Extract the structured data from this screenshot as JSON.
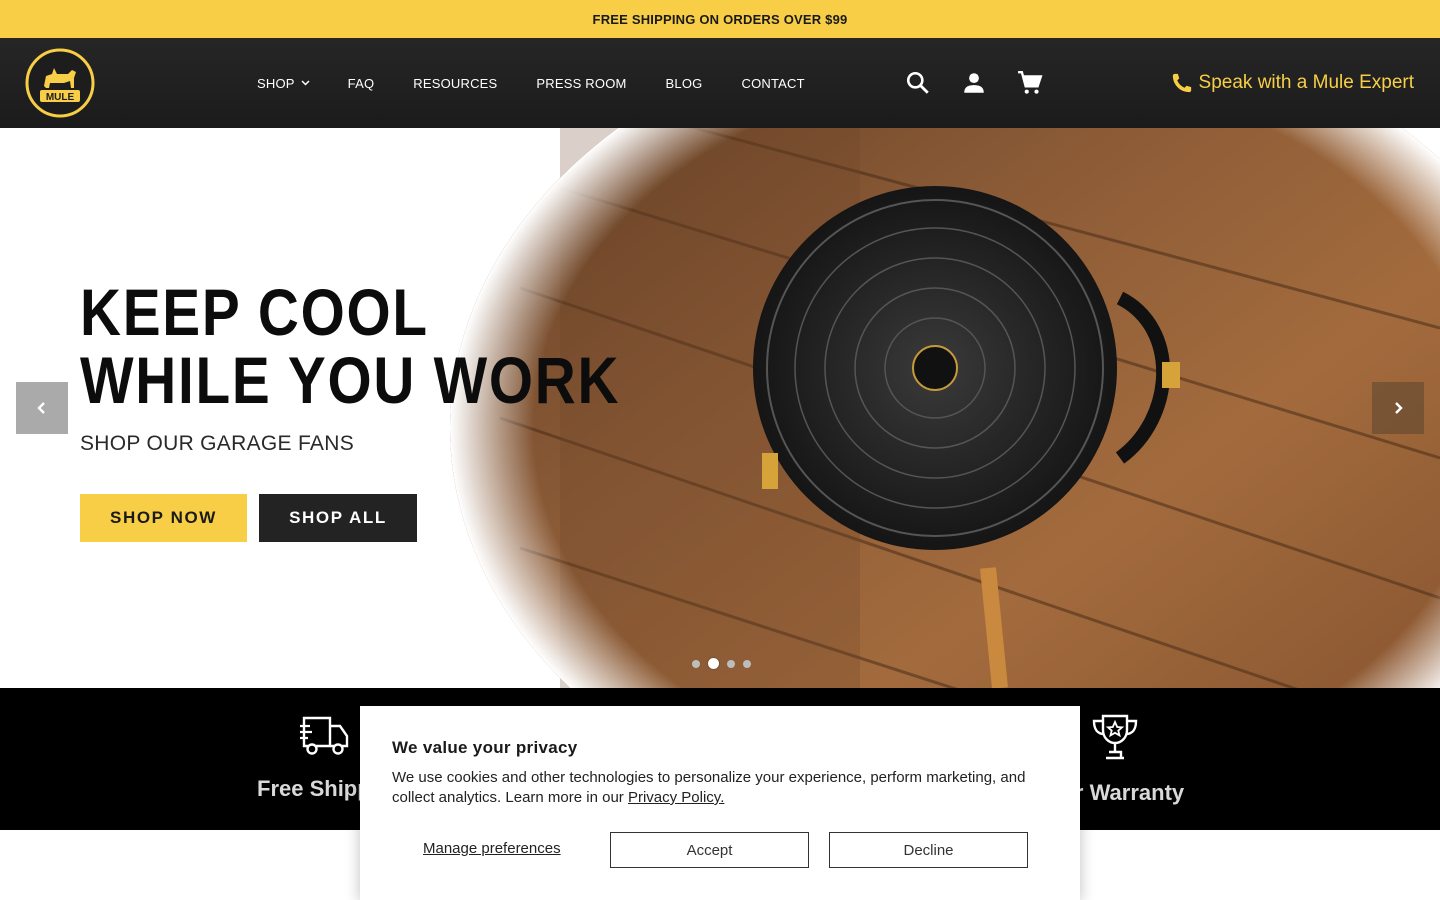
{
  "announcement": {
    "text": "FREE SHIPPING ON ORDERS OVER $99"
  },
  "header": {
    "logo_text": "MULE",
    "nav": [
      {
        "label": "SHOP",
        "has_dropdown": true
      },
      {
        "label": "FAQ"
      },
      {
        "label": "RESOURCES"
      },
      {
        "label": "PRESS ROOM"
      },
      {
        "label": "BLOG"
      },
      {
        "label": "CONTACT"
      }
    ],
    "icons": [
      "search-icon",
      "account-icon",
      "cart-icon"
    ],
    "expert_label": "Speak with a Mule Expert",
    "brand_color": "#f7ce46"
  },
  "hero": {
    "title_line1": "KEEP COOL",
    "title_line2": "WHILE YOU WORK",
    "subtitle": "SHOP OUR GARAGE FANS",
    "primary_button": "SHOP NOW",
    "secondary_button": "SHOP ALL",
    "slides_count": 4,
    "active_slide": 2
  },
  "features": [
    {
      "icon": "truck-icon",
      "label": "Free Shipping"
    },
    {
      "icon": "trophy-icon",
      "label": "Year Warranty"
    }
  ],
  "cookie": {
    "title": "We value your privacy",
    "text": "We use cookies and other technologies to personalize your experience, perform marketing, and collect analytics. Learn more in our ",
    "link": "Privacy Policy.",
    "manage": "Manage preferences",
    "accept": "Accept",
    "decline": "Decline"
  }
}
